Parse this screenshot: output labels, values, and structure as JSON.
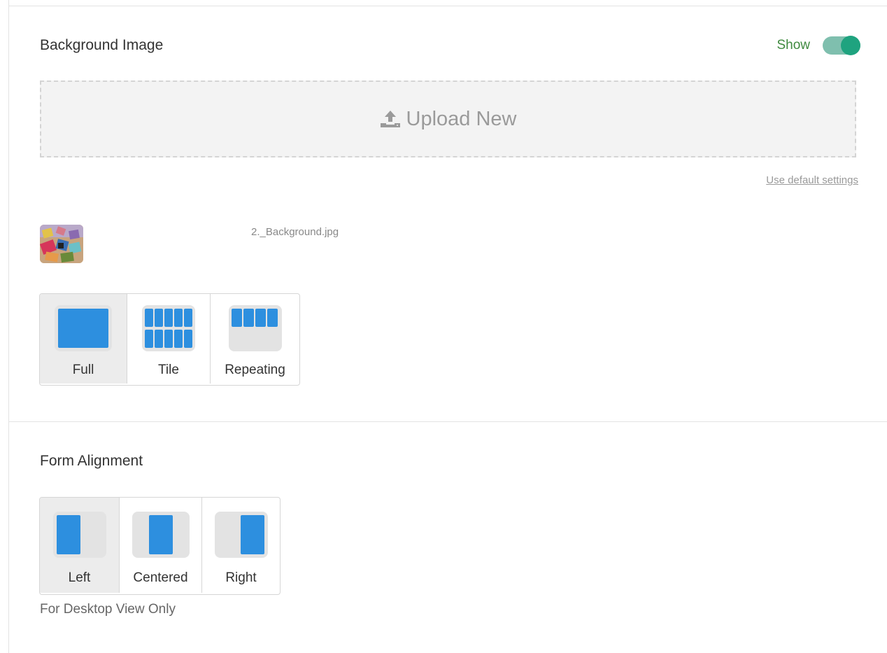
{
  "background_image": {
    "title": "Background Image",
    "show_label": "Show",
    "show_enabled": true,
    "upload_label": "Upload New",
    "default_link": "Use default settings",
    "file_name": "2._Background.jpg",
    "options": [
      {
        "label": "Full",
        "selected": true
      },
      {
        "label": "Tile",
        "selected": false
      },
      {
        "label": "Repeating",
        "selected": false
      }
    ]
  },
  "form_alignment": {
    "title": "Form Alignment",
    "options": [
      {
        "label": "Left",
        "selected": true
      },
      {
        "label": "Centered",
        "selected": false
      },
      {
        "label": "Right",
        "selected": false
      }
    ],
    "note": "For Desktop View Only"
  },
  "colors": {
    "accent": "#2d8fdf",
    "toggle_on": "#1fa37f",
    "show_text": "#3f8a3f"
  }
}
